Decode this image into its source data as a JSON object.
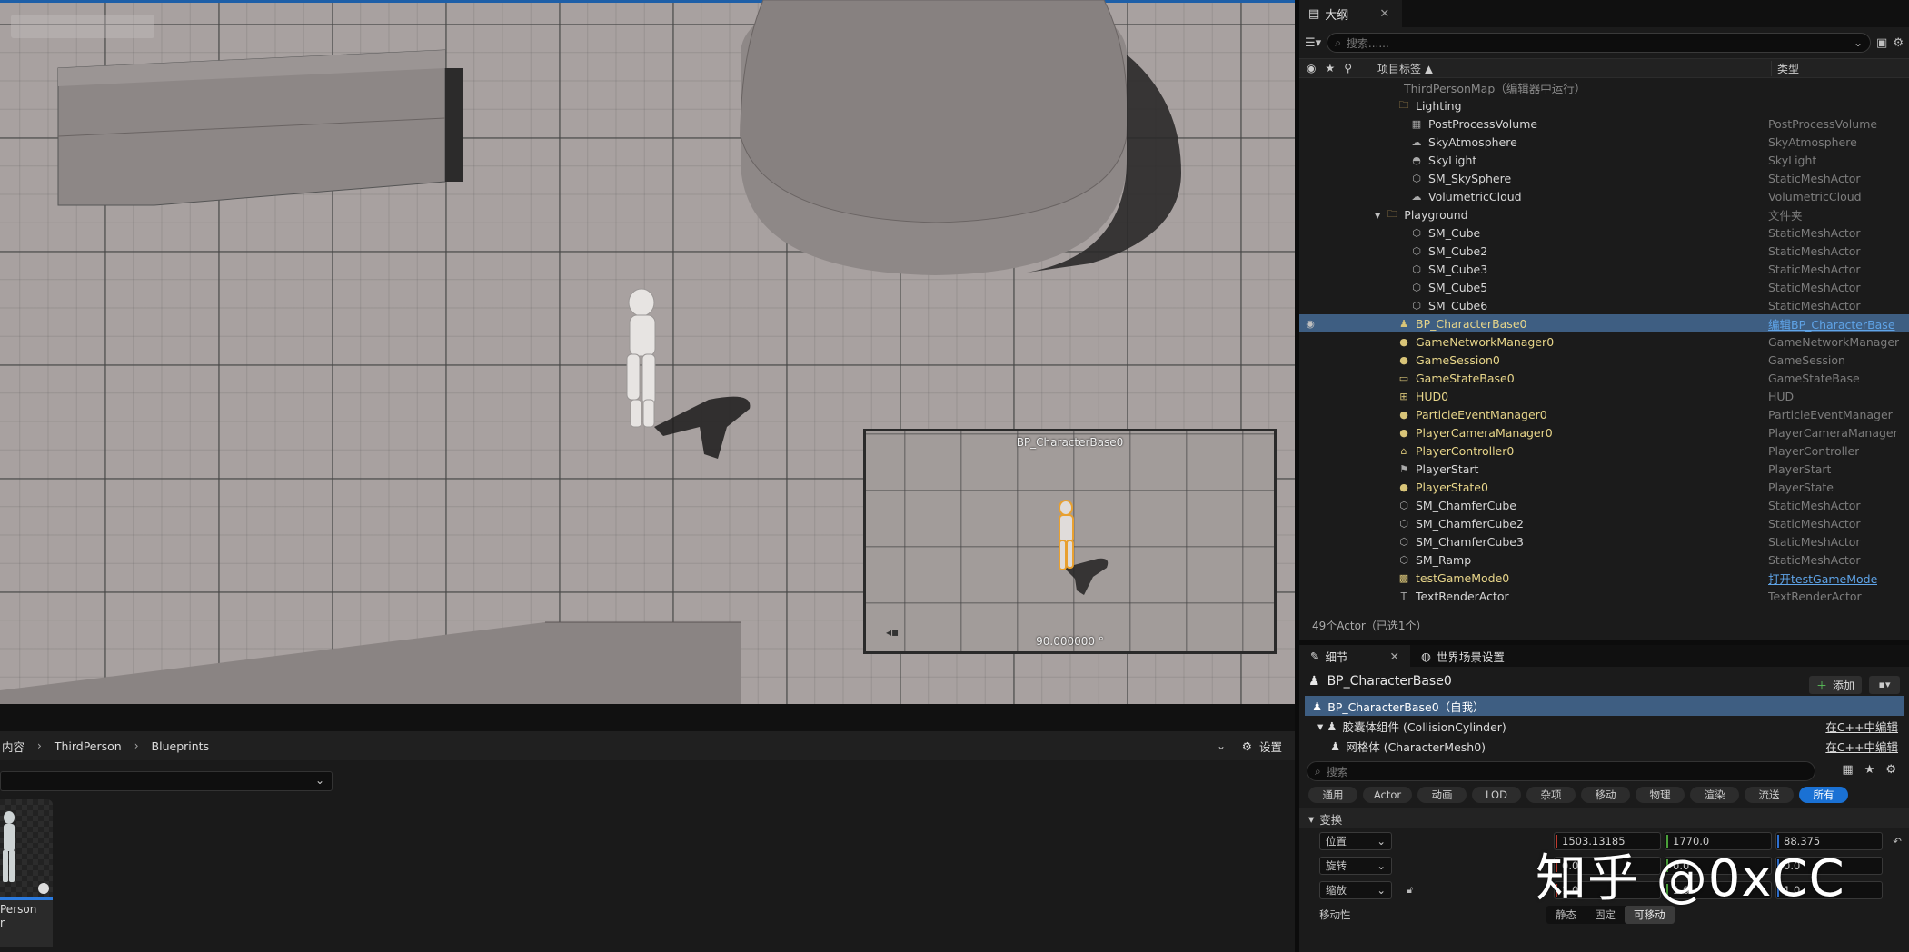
{
  "viewport": {
    "pip_title": "BP_CharacterBase0",
    "pip_angle": "90.000000 °"
  },
  "outliner": {
    "tab_label": "大纲",
    "search_placeholder": "搜索......",
    "col_label": "项目标签 ▲",
    "col_type": "类型",
    "rows": [
      {
        "name": "ThirdPersonMap（编辑器中运行）",
        "type": "",
        "indent": 95,
        "color": "gray",
        "icon": "map-icon"
      },
      {
        "name": "Lighting",
        "type": "",
        "indent": 108,
        "color": "white",
        "icon": "folder-icon"
      },
      {
        "name": "PostProcessVolume",
        "type": "PostProcessVolume",
        "indent": 122,
        "color": "white",
        "icon": "volume-icon"
      },
      {
        "name": "SkyAtmosphere",
        "type": "SkyAtmosphere",
        "indent": 122,
        "color": "white",
        "icon": "atmosphere-icon"
      },
      {
        "name": "SkyLight",
        "type": "SkyLight",
        "indent": 122,
        "color": "white",
        "icon": "skylight-icon"
      },
      {
        "name": "SM_SkySphere",
        "type": "StaticMeshActor",
        "indent": 122,
        "color": "white",
        "icon": "mesh-icon"
      },
      {
        "name": "VolumetricCloud",
        "type": "VolumetricCloud",
        "indent": 122,
        "color": "white",
        "icon": "cloud-icon"
      },
      {
        "name": "Playground",
        "type": "文件夹",
        "indent": 95,
        "color": "white",
        "icon": "folder-icon"
      },
      {
        "name": "SM_Cube",
        "type": "StaticMeshActor",
        "indent": 122,
        "color": "white",
        "icon": "mesh-icon"
      },
      {
        "name": "SM_Cube2",
        "type": "StaticMeshActor",
        "indent": 122,
        "color": "white",
        "icon": "mesh-icon"
      },
      {
        "name": "SM_Cube3",
        "type": "StaticMeshActor",
        "indent": 122,
        "color": "white",
        "icon": "mesh-icon"
      },
      {
        "name": "SM_Cube5",
        "type": "StaticMeshActor",
        "indent": 122,
        "color": "white",
        "icon": "mesh-icon"
      },
      {
        "name": "SM_Cube6",
        "type": "StaticMeshActor",
        "indent": 122,
        "color": "white",
        "icon": "mesh-icon"
      },
      {
        "name": "BP_CharacterBase0",
        "type": "编辑BP_CharacterBase",
        "indent": 108,
        "color": "yellow",
        "icon": "pawn-icon",
        "selected": true
      },
      {
        "name": "GameNetworkManager0",
        "type": "GameNetworkManager",
        "indent": 108,
        "color": "yellow",
        "icon": "actor-icon"
      },
      {
        "name": "GameSession0",
        "type": "GameSession",
        "indent": 108,
        "color": "yellow",
        "icon": "actor-icon"
      },
      {
        "name": "GameStateBase0",
        "type": "GameStateBase",
        "indent": 108,
        "color": "yellow",
        "icon": "gamestate-icon"
      },
      {
        "name": "HUD0",
        "type": "HUD",
        "indent": 108,
        "color": "yellow",
        "icon": "hud-icon"
      },
      {
        "name": "ParticleEventManager0",
        "type": "ParticleEventManager",
        "indent": 108,
        "color": "yellow",
        "icon": "actor-icon"
      },
      {
        "name": "PlayerCameraManager0",
        "type": "PlayerCameraManager",
        "indent": 108,
        "color": "yellow",
        "icon": "actor-icon"
      },
      {
        "name": "PlayerController0",
        "type": "PlayerController",
        "indent": 108,
        "color": "yellow",
        "icon": "controller-icon"
      },
      {
        "name": "PlayerStart",
        "type": "PlayerStart",
        "indent": 108,
        "color": "white",
        "icon": "flag-icon"
      },
      {
        "name": "PlayerState0",
        "type": "PlayerState",
        "indent": 108,
        "color": "yellow",
        "icon": "actor-icon"
      },
      {
        "name": "SM_ChamferCube",
        "type": "StaticMeshActor",
        "indent": 108,
        "color": "white",
        "icon": "mesh-icon"
      },
      {
        "name": "SM_ChamferCube2",
        "type": "StaticMeshActor",
        "indent": 108,
        "color": "white",
        "icon": "mesh-icon"
      },
      {
        "name": "SM_ChamferCube3",
        "type": "StaticMeshActor",
        "indent": 108,
        "color": "white",
        "icon": "mesh-icon"
      },
      {
        "name": "SM_Ramp",
        "type": "StaticMeshActor",
        "indent": 108,
        "color": "white",
        "icon": "mesh-icon"
      },
      {
        "name": "testGameMode0",
        "type": "打开testGameMode",
        "indent": 108,
        "color": "yellow",
        "icon": "gamemode-icon",
        "link": true
      },
      {
        "name": "TextRenderActor",
        "type": "TextRenderActor",
        "indent": 108,
        "color": "white",
        "icon": "text-icon"
      }
    ],
    "count": "49个Actor（已选1个）"
  },
  "details": {
    "tab_details": "细节",
    "tab_world": "世界场景设置",
    "actor_name": "BP_CharacterBase0",
    "add_label": "添加",
    "components": [
      {
        "label": "BP_CharacterBase0（自我）",
        "link": ""
      },
      {
        "label": "胶囊体组件 (CollisionCylinder)",
        "link": "在C++中编辑"
      },
      {
        "label": "网格体 (CharacterMesh0)",
        "link": "在C++中编辑"
      }
    ],
    "search_placeholder": "搜索",
    "filters": [
      "通用",
      "Actor",
      "动画",
      "LOD",
      "杂项",
      "移动",
      "物理",
      "渲染",
      "流送",
      "所有"
    ],
    "active_filter": "所有",
    "section_transform": "变换",
    "location_label": "位置",
    "rotation_label": "旋转",
    "scale_label": "缩放",
    "location": [
      "1503.13185",
      "1770.0",
      "88.375"
    ],
    "rotation": [
      "0.0",
      "0.0",
      "0.0"
    ],
    "scale": [
      "1.0",
      "1.0",
      "1.0"
    ],
    "mobility_label": "移动性",
    "mobility_options": [
      "静态",
      "固定",
      "可移动"
    ],
    "mobility_selected": "可移动"
  },
  "content_browser": {
    "crumbs": [
      "内容",
      "ThirdPerson",
      "Blueprints"
    ],
    "settings_label": "设置",
    "asset_label": "Person\nr"
  },
  "watermark": "知乎 @0xCC"
}
